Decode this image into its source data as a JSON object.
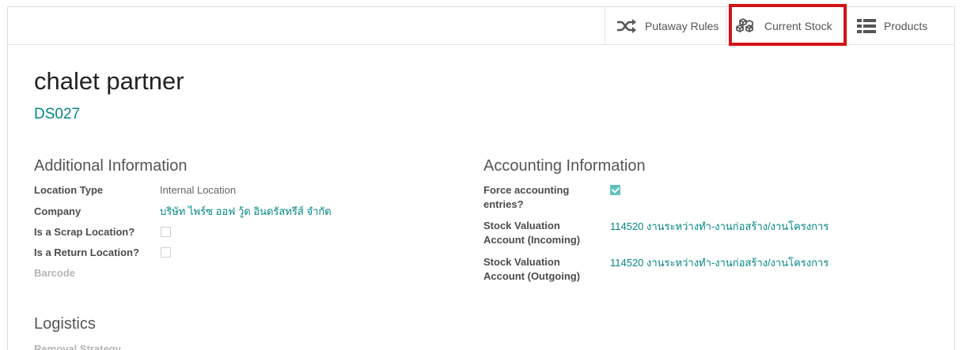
{
  "buttons": {
    "putaway": "Putaway Rules",
    "stock": "Current Stock",
    "products": "Products"
  },
  "record": {
    "name": "chalet partner",
    "code": "DS027"
  },
  "additional": {
    "title": "Additional Information",
    "location_type_label": "Location Type",
    "location_type_value": "Internal Location",
    "company_label": "Company",
    "company_value": "บริษัท ไพร์ซ ออฟ วู้ด อินดรัสทรีส์ จำกัด",
    "scrap_label": "Is a Scrap Location?",
    "scrap_checked": false,
    "return_label": "Is a Return Location?",
    "return_checked": false,
    "barcode_label": "Barcode"
  },
  "accounting": {
    "title": "Accounting Information",
    "force_label_1": "Force accounting",
    "force_label_2": "entries?",
    "force_checked": true,
    "incoming_label_1": "Stock Valuation",
    "incoming_label_2": "Account (Incoming)",
    "incoming_value": "114520 งานระหว่างทำ-งานก่อสร้าง/งานโครงการ",
    "outgoing_label_1": "Stock Valuation",
    "outgoing_label_2": "Account (Outgoing)",
    "outgoing_value": "114520 งานระหว่างทำ-งานก่อสร้าง/งานโครงการ"
  },
  "logistics": {
    "title": "Logistics",
    "removal_label": "Removal Strategy"
  },
  "colors": {
    "link": "#008784",
    "highlight": "#d21317",
    "checkbox_checked": "#5ec2c0"
  }
}
